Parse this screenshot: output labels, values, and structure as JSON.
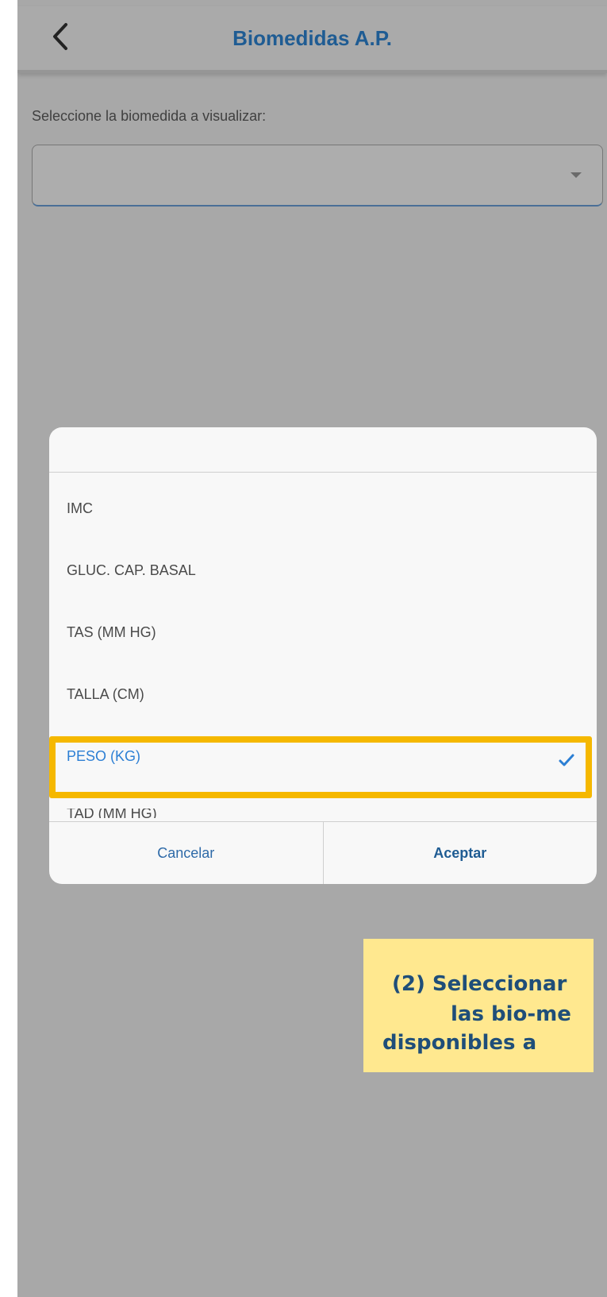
{
  "header": {
    "back_icon": "chevron-left-icon",
    "title": "Biomedidas A.P."
  },
  "form": {
    "prompt": "Seleccione la biomedida a visualizar:",
    "select_value": "",
    "select_icon": "caret-down-icon"
  },
  "dialog": {
    "options": [
      {
        "label": "IMC"
      },
      {
        "label": "GLUC. CAP. BASAL"
      },
      {
        "label": "TAS (MM HG)"
      },
      {
        "label": "TALLA (CM)"
      },
      {
        "label": "PESO (KG)",
        "selected": true
      },
      {
        "label": "TAD (MM HG)"
      }
    ],
    "check_icon": "checkmark-icon",
    "cancel_label": "Cancelar",
    "accept_label": "Aceptar"
  },
  "callout": {
    "line1": "(2) Seleccionar",
    "line2": "las bio-me",
    "line3": "disponibles a"
  },
  "colors": {
    "title": "#1f5c93",
    "selected": "#2c7fd4",
    "highlight": "#f5b800",
    "callout_bg": "#ffe88f"
  }
}
